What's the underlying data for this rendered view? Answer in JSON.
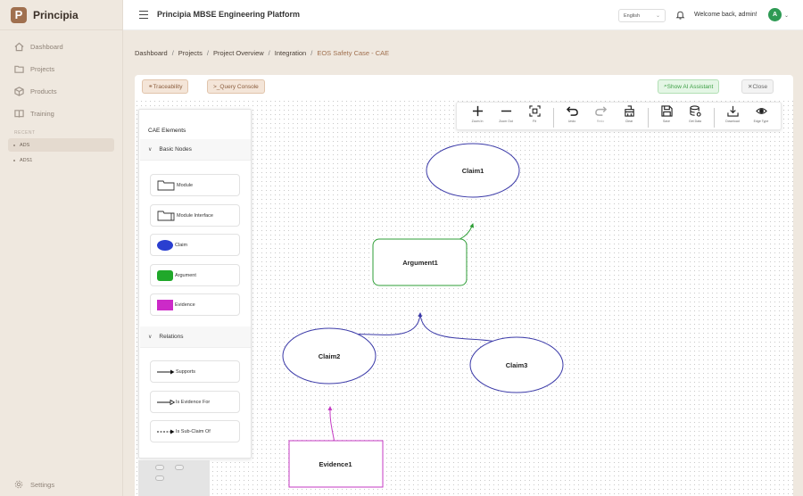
{
  "sidebar": {
    "brand_initial": "P",
    "brand_name": "Principia",
    "nav": [
      {
        "label": "Dashboard",
        "icon": "home-icon"
      },
      {
        "label": "Projects",
        "icon": "folder-icon"
      },
      {
        "label": "Products",
        "icon": "cube-icon"
      },
      {
        "label": "Training",
        "icon": "book-icon"
      }
    ],
    "recent_label": "RECENT",
    "recent": [
      {
        "label": "ADS",
        "active": true
      },
      {
        "label": "ADS1",
        "active": false
      }
    ],
    "settings_label": "Settings"
  },
  "header": {
    "title": "Principia MBSE Engineering Platform",
    "language": "English",
    "welcome": "Welcome back, admin!",
    "avatar_initial": "A"
  },
  "breadcrumb": [
    "Dashboard",
    "Projects",
    "Project Overview",
    "Integration",
    "EOS Safety Case - CAE"
  ],
  "panel_buttons": {
    "traceability": "Traceability",
    "query_console": ">_Query Console",
    "ai_assistant": "Show AI Assistant",
    "close": "Close"
  },
  "toolbar": [
    {
      "label": "Zoom In",
      "icon": "plus-icon"
    },
    {
      "label": "Zoom Out",
      "icon": "minus-icon"
    },
    {
      "label": "Fit",
      "icon": "fit-icon"
    },
    {
      "label": "Undo",
      "icon": "undo-icon"
    },
    {
      "label": "Redo",
      "icon": "redo-icon"
    },
    {
      "label": "Clear",
      "icon": "broom-icon"
    },
    {
      "label": "Save",
      "icon": "save-icon"
    },
    {
      "label": "Get Data",
      "icon": "database-icon"
    },
    {
      "label": "Download",
      "icon": "download-icon"
    },
    {
      "label": "Edge Type",
      "icon": "eye-icon"
    }
  ],
  "palette": {
    "title": "CAE Elements",
    "basic_section": "Basic Nodes",
    "basic_nodes": [
      "Module",
      "Module Interface",
      "Claim",
      "Argument",
      "Evidence"
    ],
    "relations_section": "Relations",
    "relations": [
      "Supports",
      "Is Evidence For",
      "Is Sub-Claim Of"
    ]
  },
  "diagram": {
    "nodes": {
      "claim1": "Claim1",
      "argument1": "Argument1",
      "claim2": "Claim2",
      "claim3": "Claim3",
      "evidence1": "Evidence1"
    },
    "colors": {
      "claim": "#3b3aa8",
      "argument": "#2e9e36",
      "evidence": "#c43ac3"
    }
  }
}
